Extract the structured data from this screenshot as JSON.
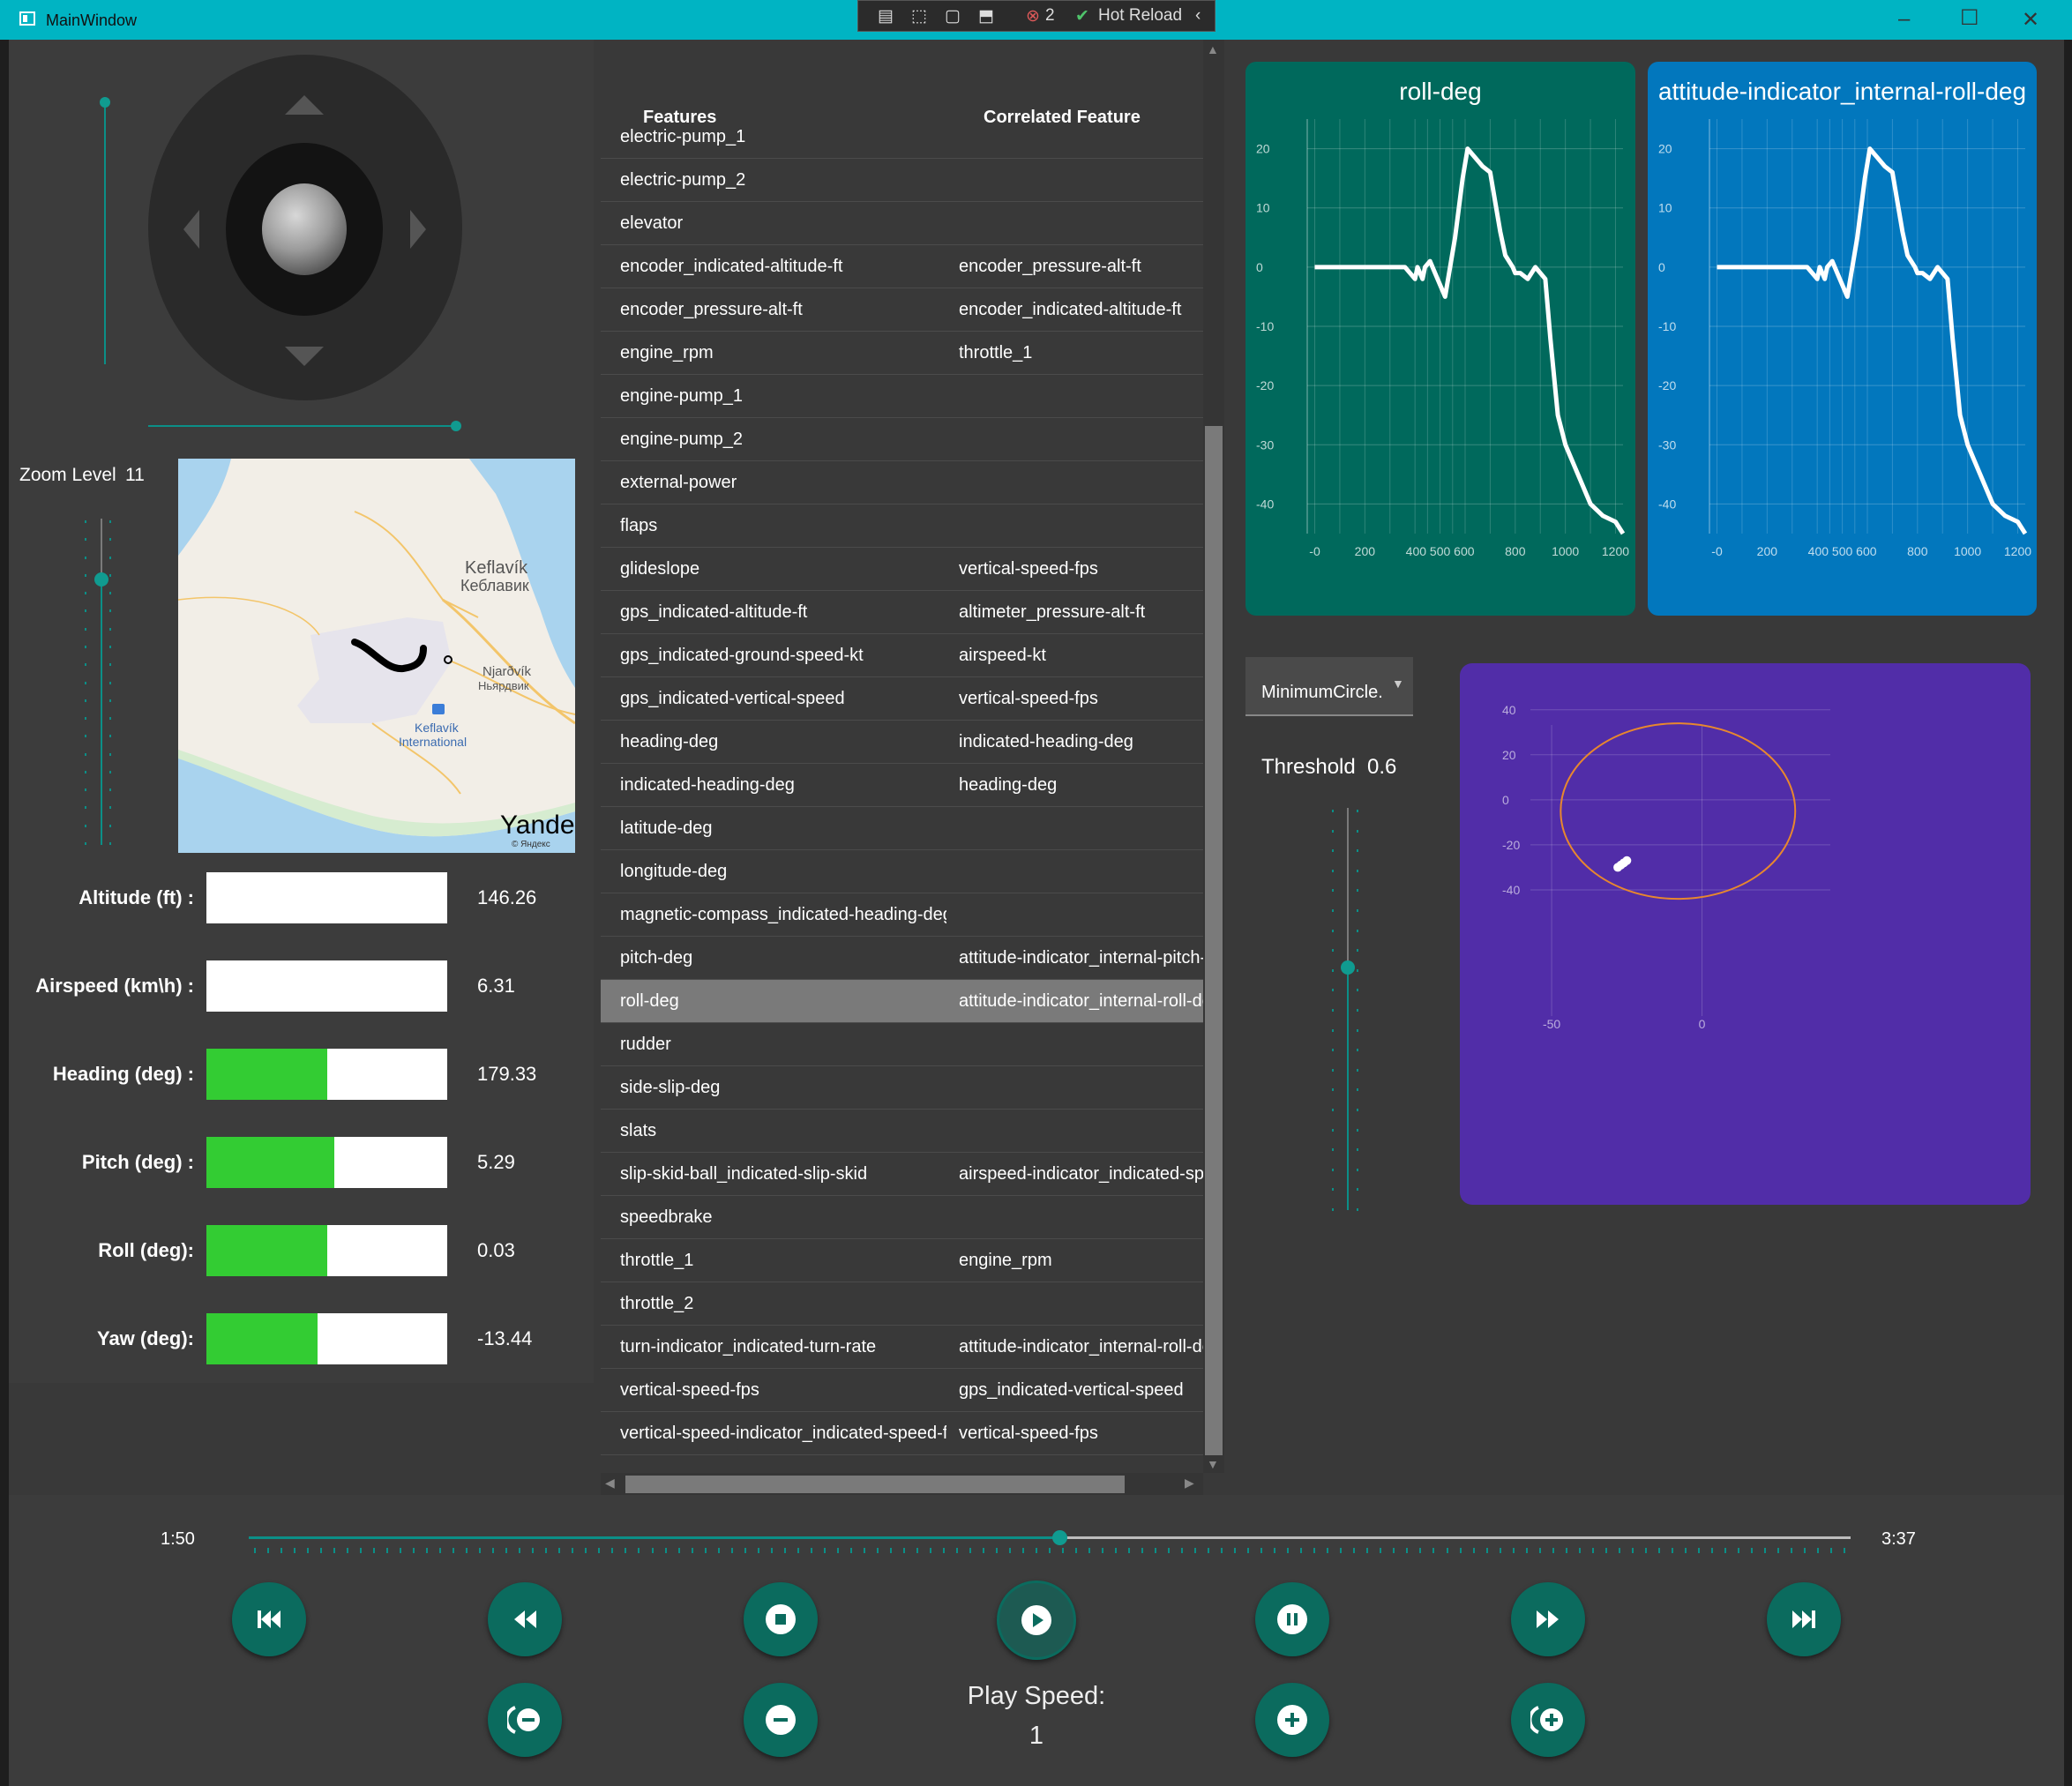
{
  "window": {
    "title": "MainWindow",
    "hot_reload_label": "Hot Reload",
    "issues_count": "2",
    "minimize_icon": "minimize-icon",
    "maximize_icon": "maximize-icon",
    "close_icon": "close-icon"
  },
  "joystick": {
    "aileron": 0.0,
    "elevator": 0.0,
    "throttle_level": 1.0,
    "rudder_level": 1.0
  },
  "map": {
    "zoom_label": "Zoom Level",
    "zoom_value": "11",
    "zoom_slider_level": 0.8,
    "labels": {
      "keflavik_latin": "Keflavík",
      "keflavik_cyrillic": "Кеблавик",
      "njardvik_latin": "Njarðvík",
      "njardvik_cyrillic": "Ньярдвик",
      "airport_line1": "Keflavík",
      "airport_line2": "International",
      "provider": "Yandex",
      "provider_sub": "© Яндекс"
    },
    "colors": {
      "land": "#f2eee7",
      "water": "#a9d3ee",
      "road": "#f3c56a",
      "path": "#000000"
    }
  },
  "indicators": [
    {
      "label": "Altitude (ft) :",
      "value": "146.26",
      "fill": 0.0
    },
    {
      "label": "Airspeed (km\\h) :",
      "value": "6.31",
      "fill": 0.0
    },
    {
      "label": "Heading (deg) :",
      "value": "179.33",
      "fill": 0.5
    },
    {
      "label": "Pitch (deg) :",
      "value": "5.29",
      "fill": 0.53
    },
    {
      "label": "Roll (deg):",
      "value": "0.03",
      "fill": 0.5
    },
    {
      "label": "Yaw (deg):",
      "value": "-13.44",
      "fill": 0.46
    }
  ],
  "table": {
    "headers": {
      "features": "Features",
      "correlated": "Correlated Feature"
    },
    "rows": [
      {
        "feature": "electric-pump_1",
        "correlated": ""
      },
      {
        "feature": "electric-pump_2",
        "correlated": ""
      },
      {
        "feature": "elevator",
        "correlated": ""
      },
      {
        "feature": "encoder_indicated-altitude-ft",
        "correlated": "encoder_pressure-alt-ft"
      },
      {
        "feature": "encoder_pressure-alt-ft",
        "correlated": "encoder_indicated-altitude-ft"
      },
      {
        "feature": "engine_rpm",
        "correlated": "throttle_1"
      },
      {
        "feature": "engine-pump_1",
        "correlated": ""
      },
      {
        "feature": "engine-pump_2",
        "correlated": ""
      },
      {
        "feature": "external-power",
        "correlated": ""
      },
      {
        "feature": "flaps",
        "correlated": ""
      },
      {
        "feature": "glideslope",
        "correlated": "vertical-speed-fps"
      },
      {
        "feature": "gps_indicated-altitude-ft",
        "correlated": "altimeter_pressure-alt-ft"
      },
      {
        "feature": "gps_indicated-ground-speed-kt",
        "correlated": "airspeed-kt"
      },
      {
        "feature": "gps_indicated-vertical-speed",
        "correlated": "vertical-speed-fps"
      },
      {
        "feature": "heading-deg",
        "correlated": "indicated-heading-deg"
      },
      {
        "feature": "indicated-heading-deg",
        "correlated": "heading-deg"
      },
      {
        "feature": "latitude-deg",
        "correlated": ""
      },
      {
        "feature": "longitude-deg",
        "correlated": ""
      },
      {
        "feature": "magnetic-compass_indicated-heading-deg",
        "correlated": ""
      },
      {
        "feature": "pitch-deg",
        "correlated": "attitude-indicator_internal-pitch-"
      },
      {
        "feature": "roll-deg",
        "correlated": "attitude-indicator_internal-roll-de",
        "selected": true
      },
      {
        "feature": "rudder",
        "correlated": ""
      },
      {
        "feature": "side-slip-deg",
        "correlated": ""
      },
      {
        "feature": "slats",
        "correlated": ""
      },
      {
        "feature": "slip-skid-ball_indicated-slip-skid",
        "correlated": "airspeed-indicator_indicated-spe"
      },
      {
        "feature": "speedbrake",
        "correlated": ""
      },
      {
        "feature": "throttle_1",
        "correlated": "engine_rpm"
      },
      {
        "feature": "throttle_2",
        "correlated": ""
      },
      {
        "feature": "turn-indicator_indicated-turn-rate",
        "correlated": "attitude-indicator_internal-roll-de"
      },
      {
        "feature": "vertical-speed-fps",
        "correlated": "gps_indicated-vertical-speed"
      },
      {
        "feature": "vertical-speed-indicator_indicated-speed-fp",
        "correlated": "vertical-speed-fps"
      }
    ]
  },
  "anomaly": {
    "algorithm": "MinimumCircle.",
    "threshold_label": "Threshold",
    "threshold_value": "0.6",
    "threshold_slider_level": 0.6
  },
  "chart_data": [
    {
      "type": "line",
      "title": "roll-deg",
      "color": "#ffffff",
      "background": "#00695c",
      "ylim": [
        -45,
        25
      ],
      "xlim": [
        -30,
        1230
      ],
      "yticks": [
        "20",
        "10",
        "0",
        "-10",
        "-20",
        "-30",
        "-40"
      ],
      "xticks": [
        "-0",
        "200",
        "400 500 600",
        "800",
        "1000",
        "1200"
      ],
      "x": [
        0,
        100,
        200,
        300,
        360,
        400,
        410,
        430,
        440,
        460,
        480,
        500,
        520,
        560,
        590,
        610,
        650,
        670,
        700,
        740,
        760,
        790,
        800,
        820,
        850,
        880,
        920,
        940,
        970,
        1000,
        1050,
        1100,
        1150,
        1200,
        1230
      ],
      "y": [
        0,
        0,
        0,
        0,
        0,
        -2,
        0,
        -2,
        0,
        1,
        -1,
        -3,
        -5,
        5,
        15,
        20,
        18,
        17,
        16,
        6,
        2,
        0,
        -1,
        -1,
        -2,
        0,
        -2,
        -12,
        -25,
        -30,
        -35,
        -40,
        -42,
        -43,
        -45
      ]
    },
    {
      "type": "line",
      "title": "attitude-indicator_internal-roll-deg",
      "color": "#ffffff",
      "background": "#0277bd",
      "ylim": [
        -45,
        25
      ],
      "xlim": [
        -30,
        1230
      ],
      "yticks": [
        "20",
        "10",
        "0",
        "-10",
        "-20",
        "-30",
        "-40"
      ],
      "xticks": [
        "-0",
        "200",
        "400 500 600",
        "800",
        "1000",
        "1200"
      ],
      "x": [
        0,
        100,
        200,
        300,
        360,
        400,
        410,
        430,
        440,
        460,
        480,
        500,
        520,
        560,
        590,
        610,
        650,
        670,
        700,
        740,
        760,
        790,
        800,
        820,
        850,
        880,
        920,
        940,
        970,
        1000,
        1050,
        1100,
        1150,
        1200,
        1230
      ],
      "y": [
        0,
        0,
        0,
        0,
        0,
        -2,
        0,
        -2,
        0,
        1,
        -1,
        -3,
        -5,
        5,
        15,
        20,
        18,
        17,
        16,
        6,
        2,
        0,
        -1,
        -1,
        -2,
        0,
        -2,
        -12,
        -25,
        -30,
        -35,
        -40,
        -42,
        -43,
        -45
      ]
    },
    {
      "type": "scatter",
      "background": "#512da8",
      "xlim": [
        -60,
        50
      ],
      "ylim": [
        -60,
        45
      ],
      "yticks": [
        "40",
        "20",
        "0",
        "-20",
        "-40"
      ],
      "xticks": [
        "-50",
        "0"
      ],
      "circle": {
        "cx": -8,
        "cy": -5,
        "r": 39,
        "color": "#e8872e"
      },
      "points": {
        "x": [
          -28,
          -27,
          -26,
          -25
        ],
        "y": [
          -30,
          -29,
          -28,
          -27
        ],
        "color": "#ffffff"
      }
    }
  ],
  "playback": {
    "current_time": "1:50",
    "total_time": "3:37",
    "progress": 0.506,
    "speed_label": "Play Speed:",
    "speed_value": "1",
    "buttons": {
      "skip_start": "skip-to-start-icon",
      "rewind": "rewind-icon",
      "stop": "stop-icon",
      "play": "play-icon",
      "pause": "pause-icon",
      "fast_forward": "fast-forward-icon",
      "skip_end": "skip-to-end-icon",
      "speed_down_fast": "double-minus-icon",
      "speed_down": "minus-icon",
      "speed_up": "plus-icon",
      "speed_up_fast": "double-plus-icon"
    }
  }
}
